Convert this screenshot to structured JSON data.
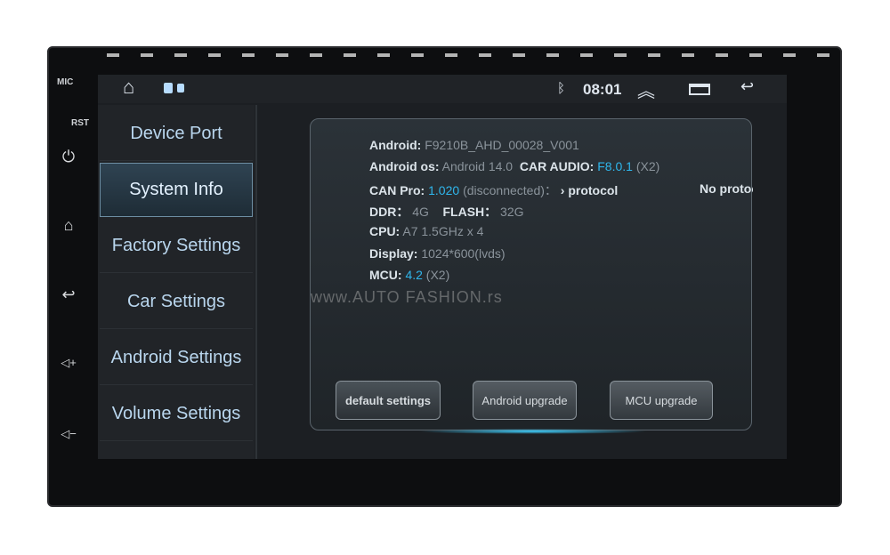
{
  "bezel": {
    "mic_label": "MIC",
    "rst_label": "RST",
    "buttons": [
      "power-icon",
      "home-icon",
      "back-icon",
      "volume-up-icon",
      "volume-down-icon"
    ]
  },
  "status_bar": {
    "time": "08:01",
    "icons": [
      "home-icon",
      "recent-apps-icon",
      "bluetooth-icon",
      "chevron-up-icon",
      "window-icon",
      "back-icon"
    ]
  },
  "sidebar": {
    "items": [
      {
        "label": "Device Port",
        "selected": false
      },
      {
        "label": "System Info",
        "selected": true
      },
      {
        "label": "Factory Settings",
        "selected": false
      },
      {
        "label": "Car Settings",
        "selected": false
      },
      {
        "label": "Android Settings",
        "selected": false
      },
      {
        "label": "Volume Settings",
        "selected": false
      }
    ]
  },
  "info": {
    "android_label": "Android:",
    "android_value": "F9210B_AHD_00028_V001",
    "os_label": "Android os:",
    "os_value": "Android 14.0",
    "car_audio_label": "CAR AUDIO:",
    "car_audio_value": "F8.0.1",
    "car_audio_suffix": "(X2)",
    "can_label": "CAN Pro:",
    "can_value": "1.020",
    "can_status": "(disconnected)：",
    "can_protocol": "› protocol",
    "can_protocol2": "No protocol/",
    "ddr_label": "DDR：",
    "ddr_value": "4G",
    "flash_label": "FLASH：",
    "flash_value": "32G",
    "cpu_label": "CPU:",
    "cpu_value": "A7 1.5GHz x 4",
    "display_label": "Display:",
    "display_value": "1024*600(lvds)",
    "mcu_label": "MCU:",
    "mcu_value": "4.2",
    "mcu_suffix": "(X2)"
  },
  "buttons": {
    "default": "default settings",
    "android_upgrade": "Android upgrade",
    "mcu_upgrade": "MCU upgrade"
  },
  "watermark": "www.AUTO FASHION.rs",
  "colors": {
    "accent": "#2fb6ec",
    "screen_bg": "#1c1f23",
    "sidebar_text": "#b9d6ee"
  }
}
